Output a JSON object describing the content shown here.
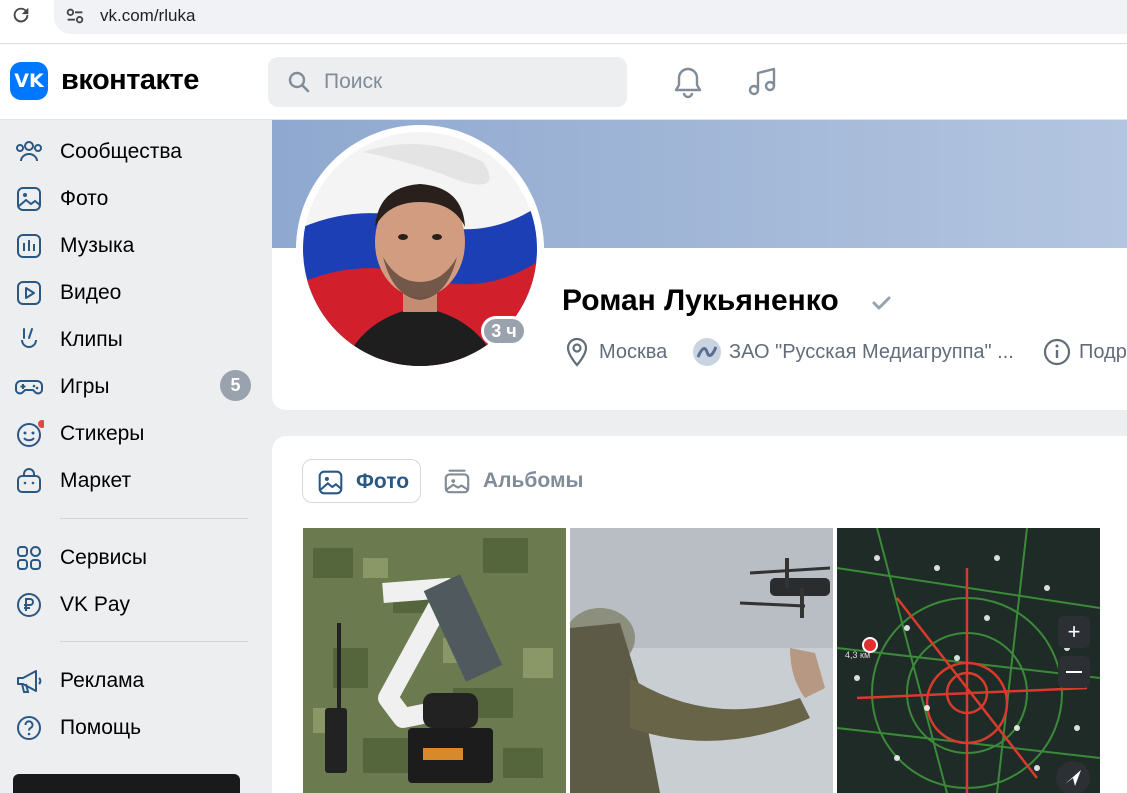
{
  "browser": {
    "url": "vk.com/rluka"
  },
  "header": {
    "logo_text": "VK",
    "wordmark": "вконтакте",
    "search_placeholder": "Поиск",
    "accent_color": "#0077ff"
  },
  "sidebar": {
    "items": [
      {
        "label": "Сообщества",
        "icon": "communities-icon"
      },
      {
        "label": "Фото",
        "icon": "photo-icon"
      },
      {
        "label": "Музыка",
        "icon": "music-icon"
      },
      {
        "label": "Видео",
        "icon": "video-icon"
      },
      {
        "label": "Клипы",
        "icon": "clips-icon"
      },
      {
        "label": "Игры",
        "icon": "games-icon",
        "badge": "5"
      },
      {
        "label": "Стикеры",
        "icon": "stickers-icon"
      },
      {
        "label": "Маркет",
        "icon": "market-icon"
      },
      {
        "label": "Сервисы",
        "icon": "services-icon"
      },
      {
        "label": "VK Pay",
        "icon": "vkpay-icon"
      },
      {
        "label": "Реклама",
        "icon": "ads-icon"
      },
      {
        "label": "Помощь",
        "icon": "help-icon"
      }
    ]
  },
  "profile": {
    "name": "Роман Лукьяненко",
    "last_seen": "3 ч",
    "city": "Москва",
    "work": "ЗАО \"Русская Медиагруппа\" ...",
    "more": "Подр"
  },
  "photos": {
    "tabs": [
      {
        "label": "Фото",
        "icon": "photo-icon",
        "active": true
      },
      {
        "label": "Альбомы",
        "icon": "albums-icon",
        "active": false
      }
    ],
    "map_distance": "4,3 км"
  }
}
